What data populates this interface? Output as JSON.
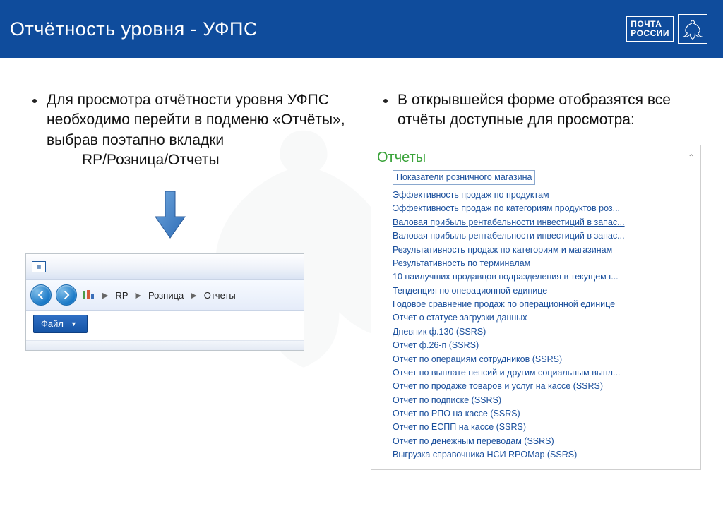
{
  "header": {
    "title": "Отчётность уровня  - УФПС",
    "logo_line1": "ПОЧТА",
    "logo_line2": "РОССИИ"
  },
  "left": {
    "bullet": "Для просмотра отчётности уровня УФПС необходимо перейти в подменю «Отчёты», выбрав поэтапно вкладки",
    "bullet_path": "RP/Розница/Отчеты"
  },
  "right": {
    "bullet": "В открывшейся форме отобразятся все отчёты доступные для просмотра:"
  },
  "breadcrumb": {
    "item1": "RP",
    "item2": "Розница",
    "item3": "Отчеты"
  },
  "browser": {
    "file_label": "Файл"
  },
  "reports": {
    "title": "Отчеты",
    "items": [
      "Показатели розничного магазина",
      "Эффективность продаж по продуктам",
      "Эффективность продаж по категориям продуктов роз...",
      "Валовая прибыль рентабельности инвестиций в запас...",
      "Валовая прибыль рентабельности инвестиций в запас...",
      "Результативность продаж по категориям и магазинам",
      "Результативность по терминалам",
      "10 наилучших продавцов подразделения в текущем г...",
      "Тенденция по операционной единице",
      "Годовое сравнение продаж по операционной единице",
      "Отчет о статусе загрузки данных",
      "Дневник ф.130 (SSRS)",
      "Отчет ф.26-п (SSRS)",
      "Отчет по операциям сотрудников (SSRS)",
      "Отчет по выплате пенсий и другим социальным выпл...",
      "Отчет по продаже товаров и услуг на кассе (SSRS)",
      "Отчет по подписке (SSRS)",
      "Отчет по РПО на кассе (SSRS)",
      "Отчет по ЕСПП на кассе (SSRS)",
      "Отчет по денежным переводам (SSRS)",
      "Выгрузка справочника НСИ RPOMap (SSRS)"
    ]
  }
}
